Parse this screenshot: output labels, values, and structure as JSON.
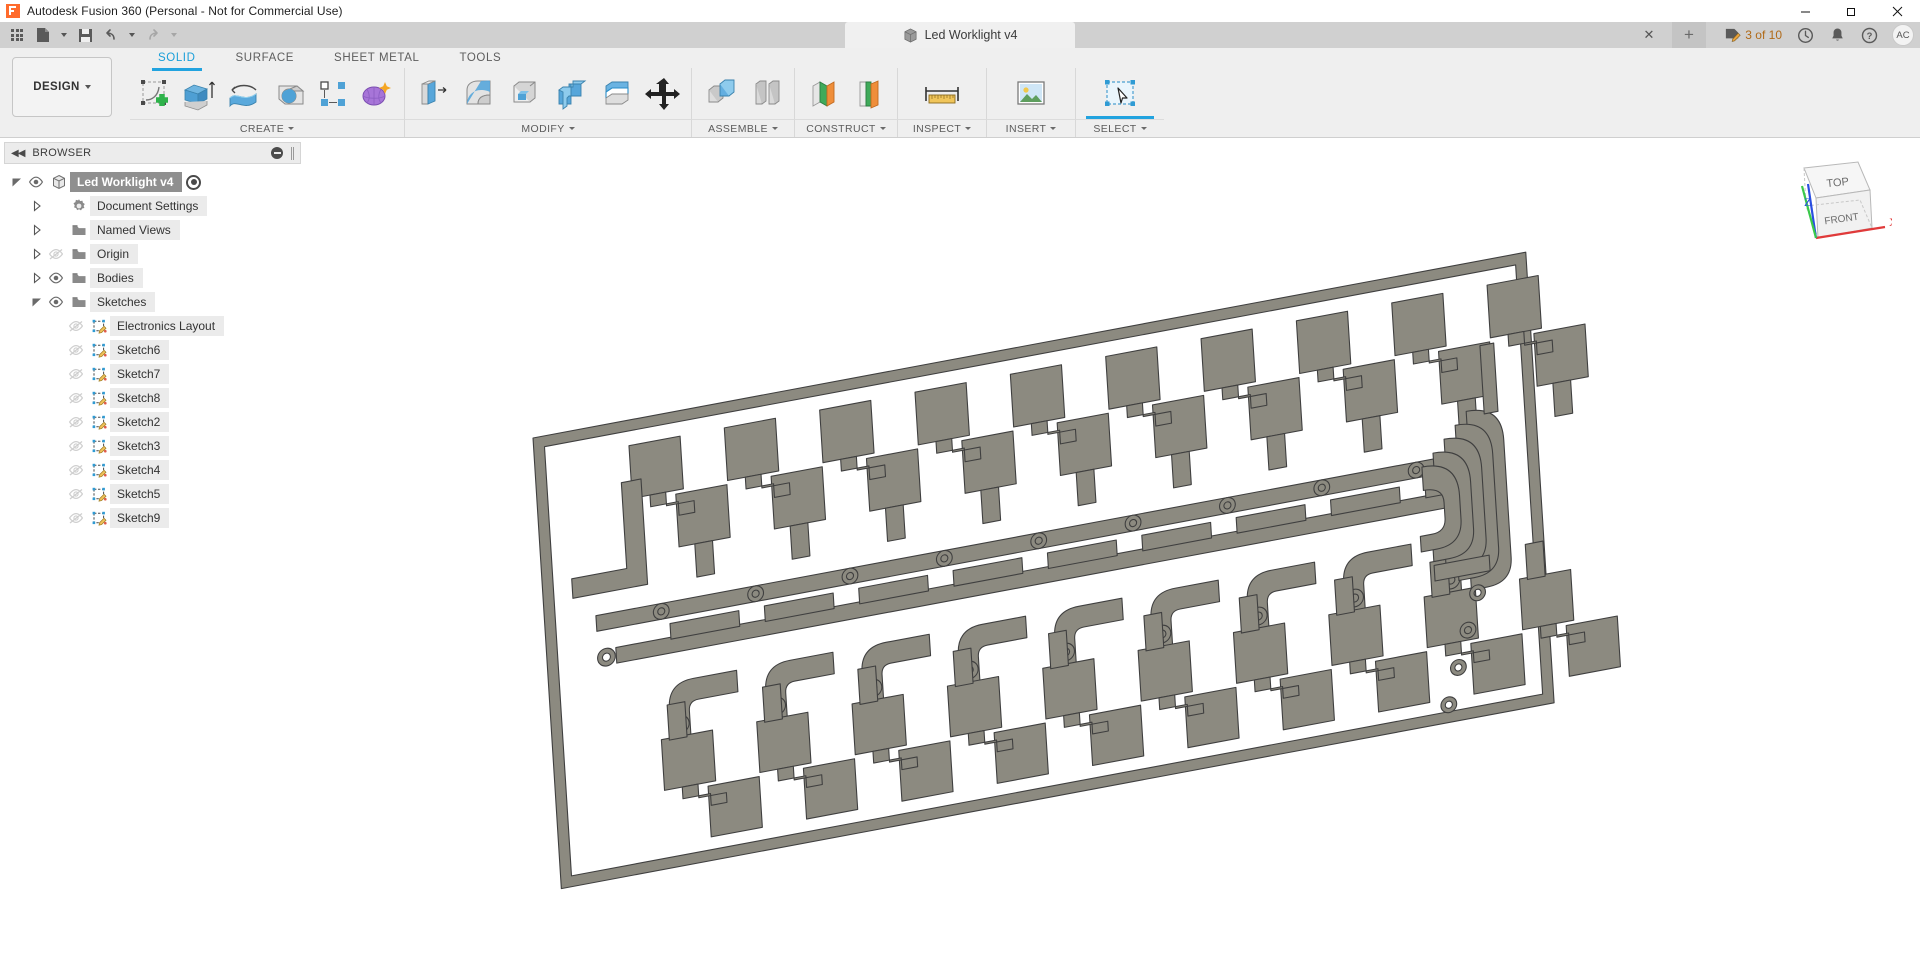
{
  "window": {
    "app_title": "Autodesk Fusion 360 (Personal - Not for Commercial Use)",
    "logo_icon": "fusion-f-logo",
    "minimize_icon": "minimize-icon",
    "maximize_icon": "maximize-icon",
    "close_icon": "close-icon"
  },
  "quick_access": {
    "grid_icon": "app-grid-icon",
    "new_icon": "new-document-icon",
    "save_icon": "save-icon",
    "undo_icon": "undo-icon",
    "redo_icon": "redo-icon",
    "dropdown_caret": "chevron-down-icon"
  },
  "document_tab": {
    "title": "Led Worklight v4",
    "doc_icon": "solid-cube-icon",
    "close_label": "✕",
    "add_tab_label": "+"
  },
  "status_right": {
    "edit_count": "3 of 10",
    "edit_icon": "edit-document-icon",
    "history_icon": "clock-icon",
    "notifications_icon": "bell-icon",
    "help_icon": "help-icon",
    "account_initials": "AC"
  },
  "design_selector": {
    "label": "DESIGN",
    "caret_icon": "chevron-down-icon"
  },
  "workspace_tabs": [
    {
      "label": "SOLID",
      "active": true
    },
    {
      "label": "SURFACE",
      "active": false
    },
    {
      "label": "SHEET METAL",
      "active": false
    },
    {
      "label": "TOOLS",
      "active": false
    }
  ],
  "ribbon_panels": [
    {
      "label": "CREATE",
      "has_caret": true,
      "buttons": [
        {
          "name": "create-sketch-button",
          "icon": "create-sketch-icon"
        },
        {
          "name": "extrude-button",
          "icon": "extrude-icon"
        },
        {
          "name": "revolve-button",
          "icon": "revolve-icon"
        },
        {
          "name": "sweep-button",
          "icon": "sweep-icon"
        },
        {
          "name": "pattern-button",
          "icon": "rect-pattern-icon"
        },
        {
          "name": "form-button",
          "icon": "create-form-icon"
        }
      ]
    },
    {
      "label": "MODIFY",
      "has_caret": true,
      "buttons": [
        {
          "name": "press-pull-button",
          "icon": "press-pull-icon"
        },
        {
          "name": "fillet-button",
          "icon": "fillet-icon"
        },
        {
          "name": "shell-button",
          "icon": "shell-icon"
        },
        {
          "name": "combine-button",
          "icon": "combine-icon"
        },
        {
          "name": "split-body-button",
          "icon": "split-body-icon"
        },
        {
          "name": "move-copy-button",
          "icon": "move-copy-icon"
        }
      ]
    },
    {
      "label": "ASSEMBLE",
      "has_caret": true,
      "buttons": [
        {
          "name": "new-component-button",
          "icon": "new-component-icon"
        },
        {
          "name": "joint-button",
          "icon": "joint-icon"
        }
      ]
    },
    {
      "label": "CONSTRUCT",
      "has_caret": true,
      "buttons": [
        {
          "name": "offset-plane-button",
          "icon": "offset-plane-icon"
        },
        {
          "name": "plane-at-angle-button",
          "icon": "plane-angle-icon"
        }
      ]
    },
    {
      "label": "INSPECT",
      "has_caret": true,
      "buttons": [
        {
          "name": "measure-button",
          "icon": "measure-icon"
        }
      ]
    },
    {
      "label": "INSERT",
      "has_caret": true,
      "buttons": [
        {
          "name": "insert-canvas-button",
          "icon": "insert-image-icon"
        }
      ]
    },
    {
      "label": "SELECT",
      "has_caret": true,
      "active": true,
      "buttons": [
        {
          "name": "select-tool-button",
          "icon": "select-arrow-icon"
        }
      ]
    }
  ],
  "browser": {
    "title": "BROWSER",
    "collapse_icon": "collapse-left-icon",
    "minus_icon": "collapse-all-icon",
    "grip_icon": "drag-grip-icon",
    "tree": [
      {
        "label": "Led Worklight v4",
        "indent": 0,
        "icon": "component-cube-icon",
        "expander": "expanded",
        "eye": "visible",
        "root": true,
        "radio": true
      },
      {
        "label": "Document Settings",
        "indent": 1,
        "icon": "gear-icon",
        "expander": "collapsed",
        "eye": "none",
        "root": false,
        "radio": false
      },
      {
        "label": "Named Views",
        "indent": 1,
        "icon": "folder-icon",
        "expander": "collapsed",
        "eye": "none",
        "root": false,
        "radio": false
      },
      {
        "label": "Origin",
        "indent": 1,
        "icon": "folder-icon",
        "expander": "collapsed",
        "eye": "hidden",
        "root": false,
        "radio": false
      },
      {
        "label": "Bodies",
        "indent": 1,
        "icon": "folder-icon",
        "expander": "collapsed",
        "eye": "visible",
        "root": false,
        "radio": false
      },
      {
        "label": "Sketches",
        "indent": 1,
        "icon": "folder-icon",
        "expander": "expanded",
        "eye": "visible",
        "root": false,
        "radio": false
      },
      {
        "label": "Electronics Layout",
        "indent": 2,
        "icon": "sketch-icon",
        "expander": "none",
        "eye": "hidden",
        "root": false,
        "radio": false
      },
      {
        "label": "Sketch6",
        "indent": 2,
        "icon": "sketch-icon",
        "expander": "none",
        "eye": "hidden",
        "root": false,
        "radio": false
      },
      {
        "label": "Sketch7",
        "indent": 2,
        "icon": "sketch-icon",
        "expander": "none",
        "eye": "hidden",
        "root": false,
        "radio": false
      },
      {
        "label": "Sketch8",
        "indent": 2,
        "icon": "sketch-icon",
        "expander": "none",
        "eye": "hidden",
        "root": false,
        "radio": false
      },
      {
        "label": "Sketch2",
        "indent": 2,
        "icon": "sketch-icon",
        "expander": "none",
        "eye": "hidden",
        "root": false,
        "radio": false
      },
      {
        "label": "Sketch3",
        "indent": 2,
        "icon": "sketch-icon",
        "expander": "none",
        "eye": "hidden",
        "root": false,
        "radio": false
      },
      {
        "label": "Sketch4",
        "indent": 2,
        "icon": "sketch-icon",
        "expander": "none",
        "eye": "hidden",
        "root": false,
        "radio": false
      },
      {
        "label": "Sketch5",
        "indent": 2,
        "icon": "sketch-icon",
        "expander": "none",
        "eye": "hidden",
        "root": false,
        "radio": false
      },
      {
        "label": "Sketch9",
        "indent": 2,
        "icon": "sketch-icon",
        "expander": "none",
        "eye": "hidden",
        "root": false,
        "radio": false
      }
    ]
  },
  "viewcube": {
    "top_face_label": "TOP",
    "front_face_label": "FRONT",
    "axis_z_label": "Z",
    "axis_x_label": "X",
    "axis_z_color": "#2a4ee0",
    "axis_x_color": "#e03a3a",
    "axis_y_color": "#3ac94a"
  },
  "model": {
    "name": "led-worklight-pcb-body",
    "fill_color": "#8c8a80",
    "edge_color": "#3f3f3f",
    "description": "Isometric PCB board with copper pads, traces and via holes"
  },
  "theme": {
    "accent": "#22a3df",
    "titlebar_bg": "#ffffff",
    "appbar_bg": "#d0d0d0",
    "ribbon_bg": "#efefef",
    "canvas_bg": "#ffffff",
    "orange": "#b06a18"
  }
}
